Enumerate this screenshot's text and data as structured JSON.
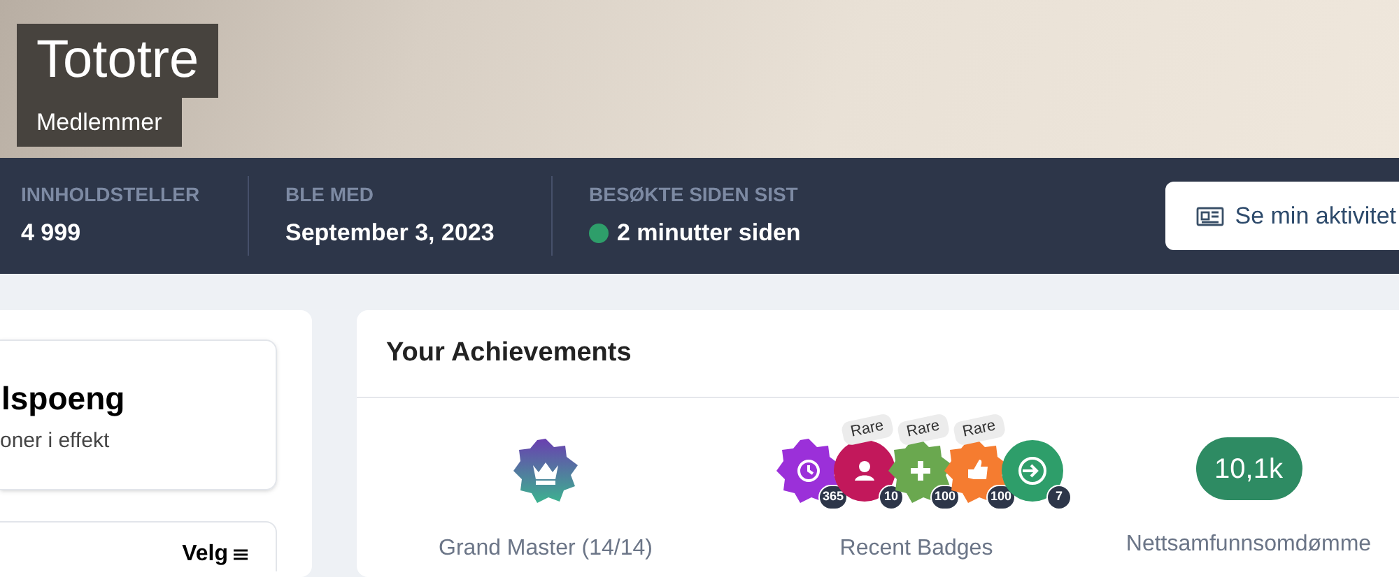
{
  "profile": {
    "name": "Tototre",
    "group": "Medlemmer"
  },
  "stats": [
    {
      "label": "INNHOLDSTELLER",
      "value": "4 999",
      "online": false
    },
    {
      "label": "BLE MED",
      "value": "September 3, 2023",
      "online": false
    },
    {
      "label": "BESØKTE SIDEN SIST",
      "value": "2 minutter siden",
      "online": true
    }
  ],
  "activity_button": {
    "label": "Se min aktivitet"
  },
  "sidebar": {
    "points_card": {
      "title": "lspoeng",
      "subtitle": "oner i effekt"
    },
    "filter": {
      "label": "Velg"
    }
  },
  "achievements": {
    "title": "Your Achievements",
    "rank": {
      "label": "Grand Master (14/14)"
    },
    "badges": [
      {
        "count": "365",
        "color": "#9b30d9",
        "kind": "clock"
      },
      {
        "count": "10",
        "tag": "Rare",
        "color": "#c2185b",
        "kind": "person"
      },
      {
        "count": "100",
        "tag": "Rare",
        "color": "#6aa84f",
        "kind": "plus"
      },
      {
        "count": "100",
        "tag": "Rare",
        "color": "#f57c30",
        "kind": "thumb"
      },
      {
        "count": "7",
        "color": "#2e9e6a",
        "kind": "enter"
      }
    ],
    "badges_label": "Recent Badges",
    "reputation": {
      "value": "10,1k",
      "label": "Nettsamfunnsomdømme"
    }
  }
}
